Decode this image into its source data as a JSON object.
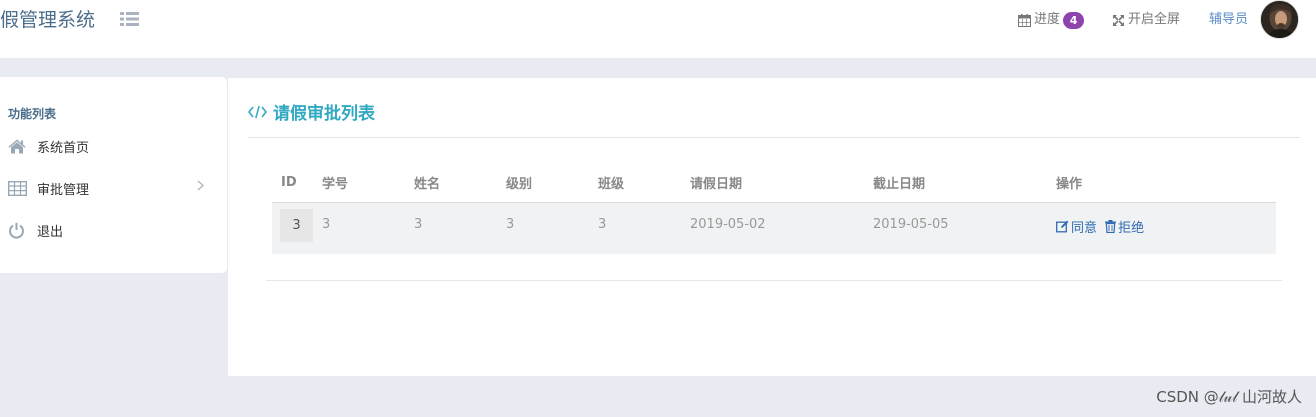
{
  "header": {
    "brand": "假管理系统",
    "progress_label": "进度",
    "progress_count": "4",
    "fullscreen_label": "开启全屏",
    "user_name": "辅导员"
  },
  "sidebar": {
    "heading": "功能列表",
    "items": [
      {
        "label": "系统首页",
        "icon": "home-icon"
      },
      {
        "label": "审批管理",
        "icon": "table-icon"
      },
      {
        "label": "退出",
        "icon": "power-icon"
      }
    ]
  },
  "main": {
    "title": "请假审批列表",
    "columns": [
      "ID",
      "学号",
      "姓名",
      "级别",
      "班级",
      "请假日期",
      "截止日期",
      "操作"
    ],
    "rows": [
      {
        "id": "3",
        "student_no": "3",
        "name": "3",
        "level": "3",
        "class": "3",
        "start_date": "2019-05-02",
        "end_date": "2019-05-05",
        "approve_label": "同意",
        "reject_label": "拒绝"
      }
    ]
  },
  "watermark": "CSDN @𝓁𝓊𝓁 山河故人",
  "colors": {
    "accent": "#31a9c2",
    "brand": "#4a6d8c",
    "badge": "#8e44ad",
    "link": "#2f6bb0",
    "page_bg": "#e8ebf1"
  }
}
